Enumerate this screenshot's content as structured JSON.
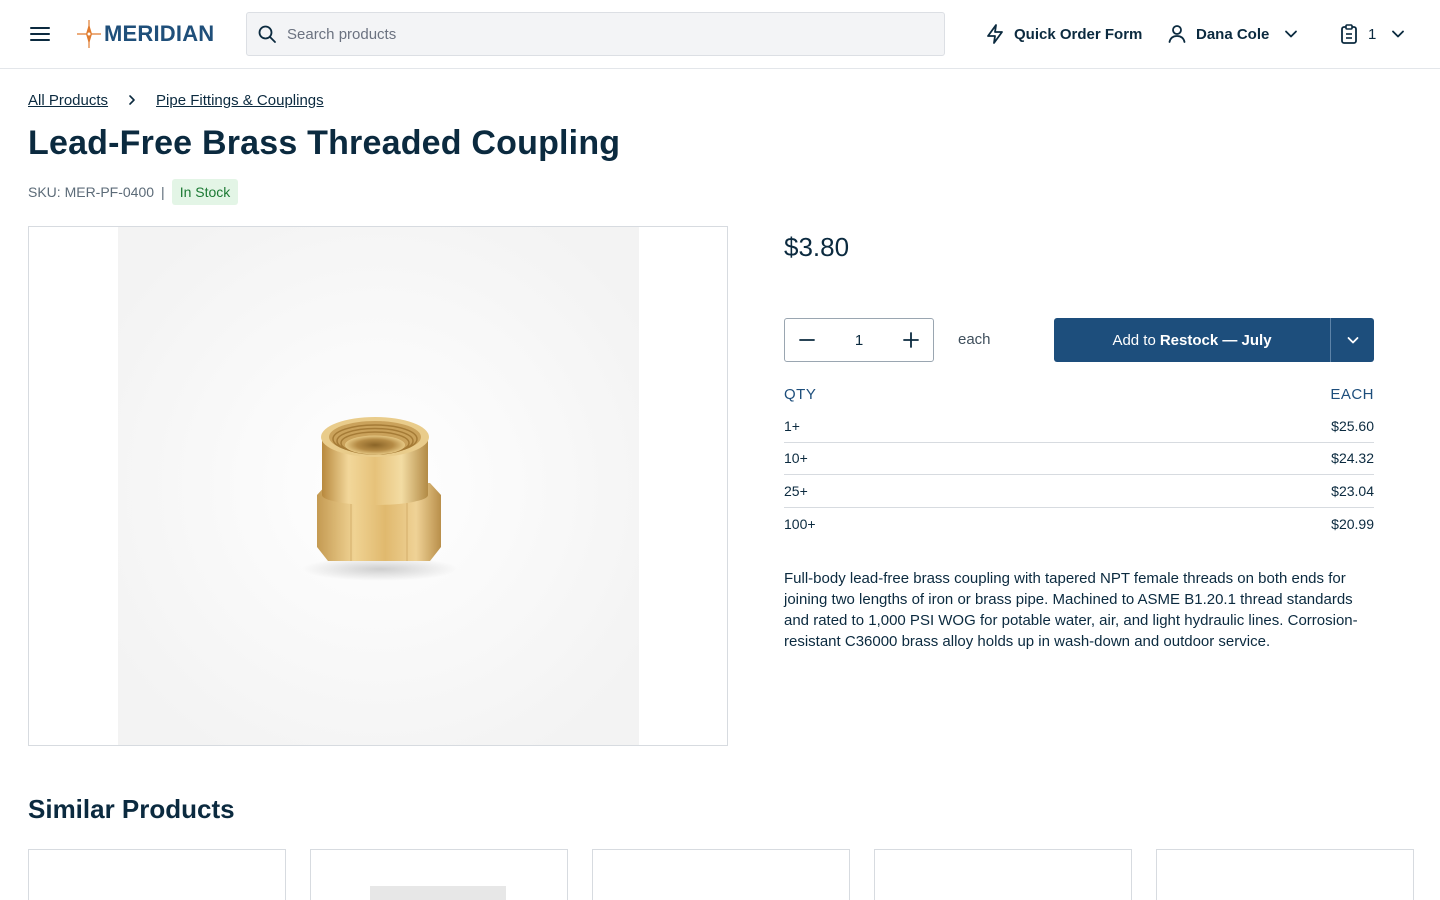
{
  "header": {
    "logo_text": "MERIDIAN",
    "search_placeholder": "Search products",
    "quick_order_label": "Quick Order Form",
    "user_name": "Dana Cole",
    "cart_count": "1"
  },
  "breadcrumb": {
    "items": [
      "All Products",
      "Pipe Fittings & Couplings"
    ]
  },
  "product": {
    "title": "Lead-Free Brass Threaded Coupling",
    "sku": "SKU: MER-PF-0400",
    "sku_separator": "|",
    "stock_status": "In Stock",
    "price": "$3.80",
    "quantity": "1",
    "unit": "each",
    "add_to_prefix": "Add to",
    "add_to_list": "Restock — July",
    "description": "Full-body lead-free brass coupling with tapered NPT female threads on both ends for joining two lengths of iron or brass pipe. Machined to ASME B1.20.1 thread standards and rated to 1,000 PSI WOG for potable water, air, and light hydraulic lines. Corrosion-resistant C36000 brass alloy holds up in wash-down and outdoor service."
  },
  "price_tiers": {
    "headers": [
      "QTY",
      "EACH"
    ],
    "rows": [
      {
        "qty": "1+",
        "each": "$25.60"
      },
      {
        "qty": "10+",
        "each": "$24.32"
      },
      {
        "qty": "25+",
        "each": "$23.04"
      },
      {
        "qty": "100+",
        "each": "$20.99"
      }
    ]
  },
  "similar": {
    "title": "Similar Products"
  },
  "colors": {
    "primary": "#1d4e7c",
    "text": "#0b2a3f",
    "in_stock_bg": "#e3f5e6",
    "in_stock_text": "#1c7a34",
    "logo_accent": "#e07b2e"
  },
  "icons": {
    "menu": "menu-icon",
    "search": "search-icon",
    "quick_order": "lightning-icon",
    "user": "user-icon",
    "cart": "clipboard-icon",
    "chevron": "chevron-down-icon"
  }
}
